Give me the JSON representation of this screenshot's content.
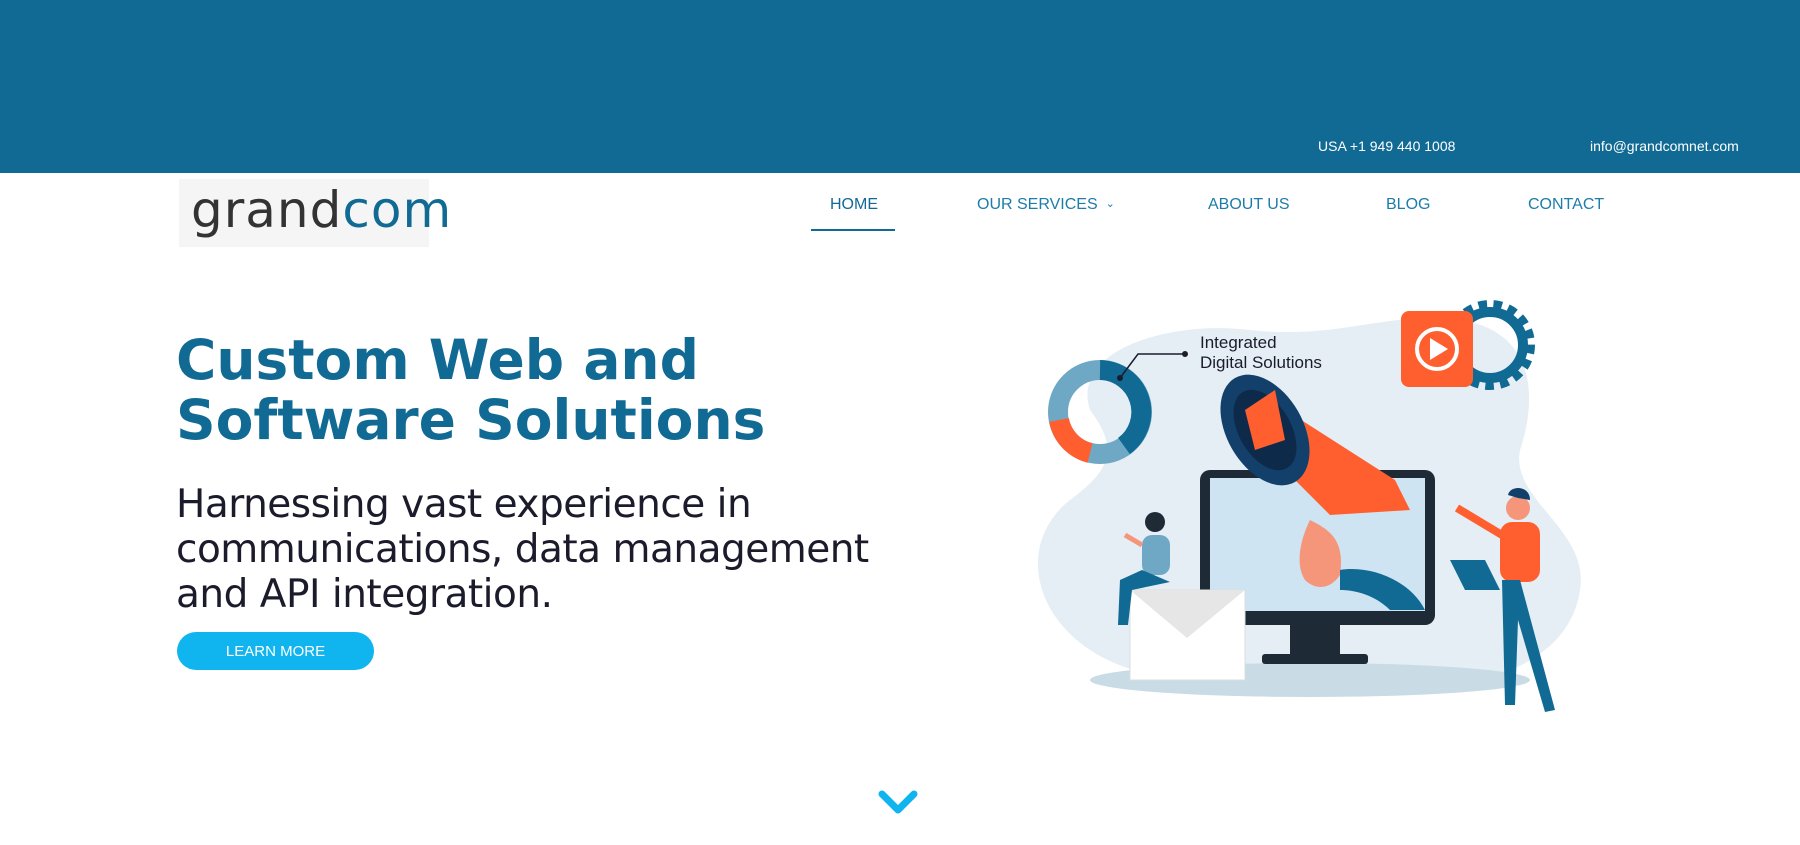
{
  "topbar": {
    "phone": "USA +1 949 440 1008",
    "email": "info@grandcomnet.com"
  },
  "logo": {
    "part1": "grand",
    "part2": "com"
  },
  "nav": {
    "items": [
      {
        "label": "HOME",
        "active": true
      },
      {
        "label": "OUR SERVICES",
        "dropdown": true
      },
      {
        "label": "ABOUT US"
      },
      {
        "label": "BLOG"
      },
      {
        "label": "CONTACT"
      }
    ]
  },
  "hero": {
    "title_line1": "Custom Web and",
    "title_line2": "Software Solutions",
    "subtitle": "Harnessing vast experience in communications, data management and API integration.",
    "cta_label": "LEARN MORE"
  },
  "illustration": {
    "callout_line1": "Integrated",
    "callout_line2": "Digital Solutions"
  },
  "colors": {
    "brand_blue": "#116a94",
    "nav_blue": "#1d7ca9",
    "cta_blue": "#10b5ef",
    "orange": "#ff5f2e",
    "dark_text": "#1b1b2b"
  },
  "icons": {
    "services_dropdown": "chevron-down-icon",
    "scroll_down": "chevron-down-icon"
  }
}
